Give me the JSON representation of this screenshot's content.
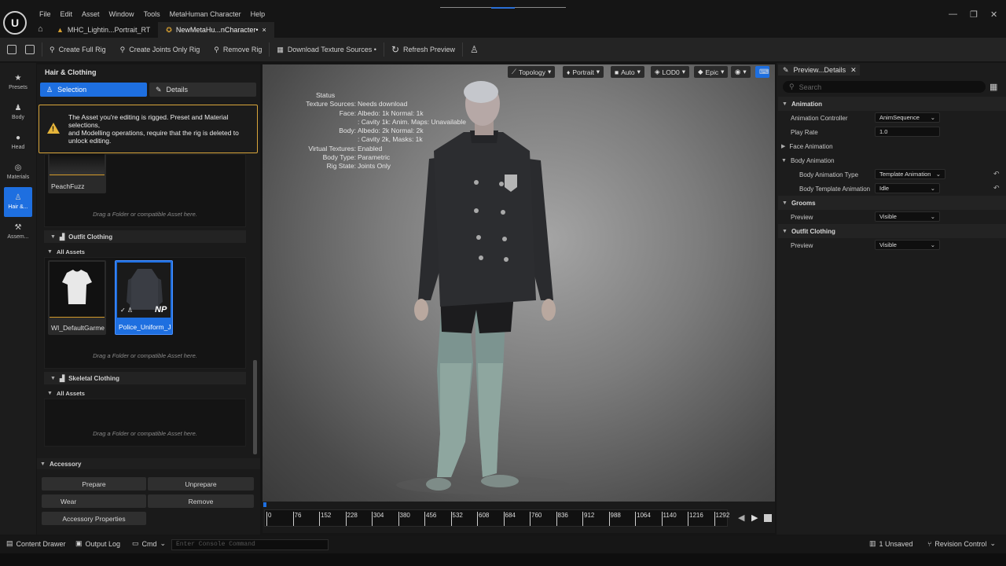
{
  "menu": [
    "File",
    "Edit",
    "Asset",
    "Window",
    "Tools",
    "MetaHuman Character",
    "Help"
  ],
  "tabs": [
    {
      "label": "MHC_Lightin...Portrait_RT"
    },
    {
      "label": "NewMetaHu...nCharacter•",
      "close": "×"
    }
  ],
  "toolbar": {
    "create_full_rig": "Create Full Rig",
    "create_joints_only_rig": "Create Joints Only Rig",
    "remove_rig": "Remove Rig",
    "download_texture_sources": "Download Texture Sources •",
    "refresh_preview": "Refresh Preview"
  },
  "leftnav": [
    {
      "label": "Presets",
      "icon": "star-icon"
    },
    {
      "label": "Body",
      "icon": "body-icon"
    },
    {
      "label": "Head",
      "icon": "head-icon"
    },
    {
      "label": "Materials",
      "icon": "materials-icon"
    },
    {
      "label": "Hair &...",
      "icon": "hair-icon",
      "active": true
    },
    {
      "label": "Assem...",
      "icon": "assembly-icon"
    }
  ],
  "panel": {
    "title": "Hair & Clothing",
    "selection_tab": "Selection",
    "details_tab": "Details",
    "warning": [
      "The Asset you're editing is rigged. Preset and Material selections,",
      "and Modelling operations, require that the rig is deleted to unlock editing."
    ],
    "peachfuzz_label": "PeachFuzz",
    "drop_hint": "Drag a Folder or compatible Asset here.",
    "outfit_clothing": "Outfit Clothing",
    "all_assets": "All Assets",
    "garment_1": "WI_DefaultGarment",
    "garment_2": "Police_Uniform_J...",
    "np_badge": "NP",
    "skeletal_clothing": "Skeletal Clothing",
    "accessory": "Accessory",
    "prepare": "Prepare",
    "unprepare": "Unprepare",
    "wear": "Wear",
    "remove": "Remove",
    "accessory_properties": "Accessory Properties"
  },
  "viewport": {
    "buttons": [
      "Topology",
      "Portrait",
      "Auto",
      "LOD0",
      "Epic"
    ],
    "status_title": "Status",
    "status": [
      {
        "k": "Texture Sources:",
        "v": "Needs download"
      },
      {
        "k": "Face:",
        "v": "Albedo: 1k Normal: 1k"
      },
      {
        "k": "",
        "v": ": Cavity 1k: Anim. Maps: Unavailable"
      },
      {
        "k": "Body:",
        "v": "Albedo: 2k Normal: 2k"
      },
      {
        "k": "",
        "v": ": Cavity 2k, Masks: 1k"
      },
      {
        "k": "Virtual Textures:",
        "v": "Enabled"
      },
      {
        "k": "Body Type:",
        "v": "Parametric"
      },
      {
        "k": "Rig State:",
        "v": "Joints Only"
      }
    ]
  },
  "timeline": {
    "ticks": [
      "0",
      "76",
      "152",
      "228",
      "304",
      "380",
      "456",
      "532",
      "608",
      "684",
      "760",
      "836",
      "912",
      "988",
      "1064",
      "1140",
      "1216",
      "1292"
    ]
  },
  "details": {
    "tab": "Preview...Details",
    "search_placeholder": "Search",
    "animation": "Animation",
    "animation_controller_label": "Animation Controller",
    "animation_controller_value": "AnimSequence",
    "play_rate_label": "Play Rate",
    "play_rate_value": "1.0",
    "face_animation": "Face Animation",
    "body_animation": "Body Animation",
    "body_animation_type_label": "Body Animation Type",
    "body_animation_type_value": "Template Animation",
    "body_template_animation_label": "Body Template Animation",
    "body_template_animation_value": "Idle",
    "grooms": "Grooms",
    "grooms_preview_label": "Preview",
    "grooms_preview_value": "Visible",
    "outfit_clothing": "Outfit Clothing",
    "outfit_preview_label": "Preview",
    "outfit_preview_value": "Visible"
  },
  "statusbar": {
    "content_drawer": "Content Drawer",
    "output_log": "Output Log",
    "cmd": "Cmd",
    "console_placeholder": "Enter Console Command",
    "unsaved": "1 Unsaved",
    "revision_control": "Revision Control"
  }
}
